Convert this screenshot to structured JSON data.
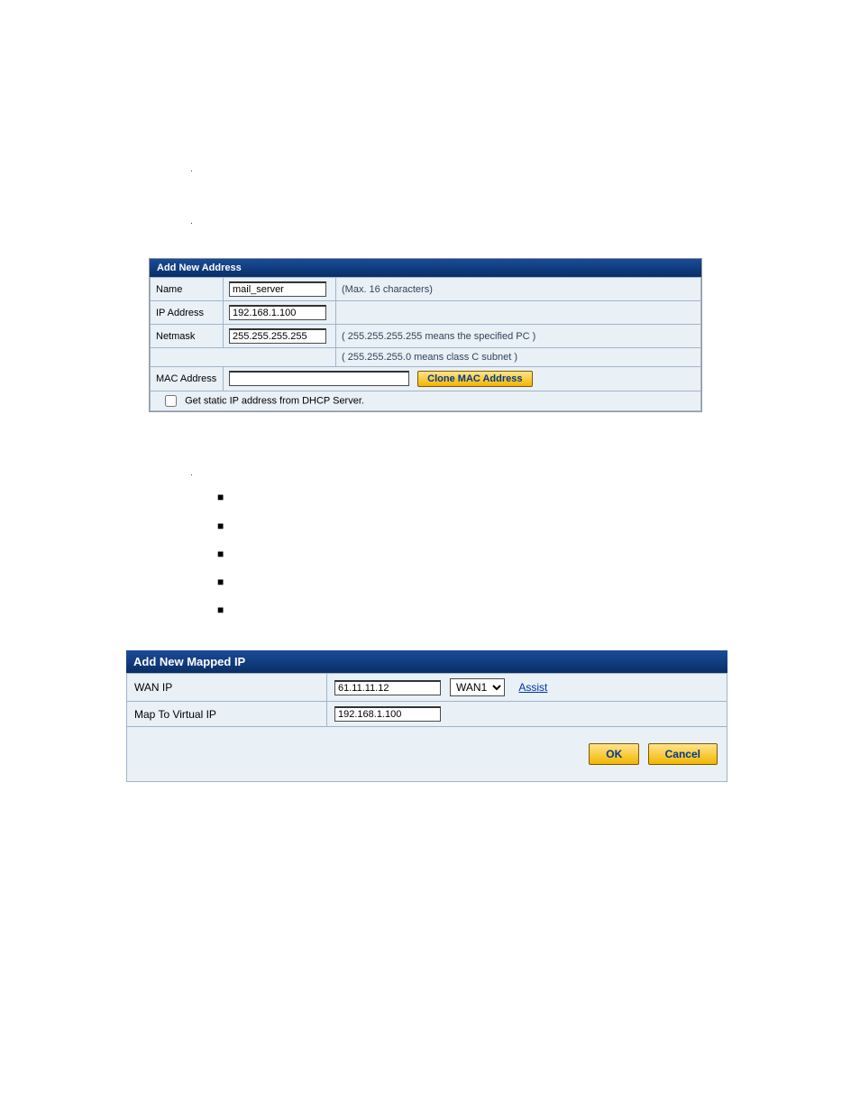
{
  "addr_panel": {
    "title": "Add New Address",
    "rows": {
      "name_label": "Name",
      "name_value": "mail_server",
      "name_hint": "(Max. 16 characters)",
      "ip_label": "IP Address",
      "ip_value": "192.168.1.100",
      "netmask_label": "Netmask",
      "netmask_value": "255.255.255.255",
      "netmask_hint1": "( 255.255.255.255 means the specified PC )",
      "netmask_hint2": "( 255.255.255.0 means class C subnet )",
      "mac_label": "MAC Address",
      "mac_value": "",
      "clone_btn": "Clone MAC Address",
      "dhcp_checkbox_label": "Get static IP address from DHCP Server."
    }
  },
  "mapped_panel": {
    "title": "Add New Mapped IP",
    "wan_label": "WAN IP",
    "wan_value": "61.11.11.12",
    "wan_iface_selected": "WAN1",
    "assist_label": "Assist",
    "map_label": "Map To Virtual IP",
    "map_value": "192.168.1.100",
    "ok_btn": "OK",
    "cancel_btn": "Cancel"
  }
}
